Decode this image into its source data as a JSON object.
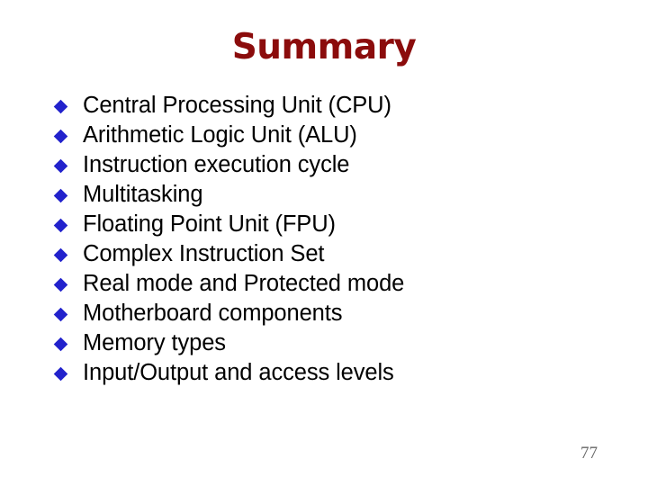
{
  "slide": {
    "title": "Summary",
    "title_color": "#8B0C0C",
    "background_color": "#FFFFFF",
    "bullet_color": "#2222CC",
    "body_text_color": "#000000",
    "page_number": "77",
    "page_number_color": "#666666",
    "bullet_glyph": "diamond-bullet",
    "items": [
      {
        "label": "Central Processing Unit (CPU)"
      },
      {
        "label": "Arithmetic Logic Unit (ALU)"
      },
      {
        "label": "Instruction execution cycle"
      },
      {
        "label": "Multitasking"
      },
      {
        "label": "Floating Point Unit (FPU)"
      },
      {
        "label": "Complex Instruction Set"
      },
      {
        "label": "Real mode and Protected mode"
      },
      {
        "label": "Motherboard components"
      },
      {
        "label": "Memory types"
      },
      {
        "label": "Input/Output and access levels"
      }
    ]
  }
}
